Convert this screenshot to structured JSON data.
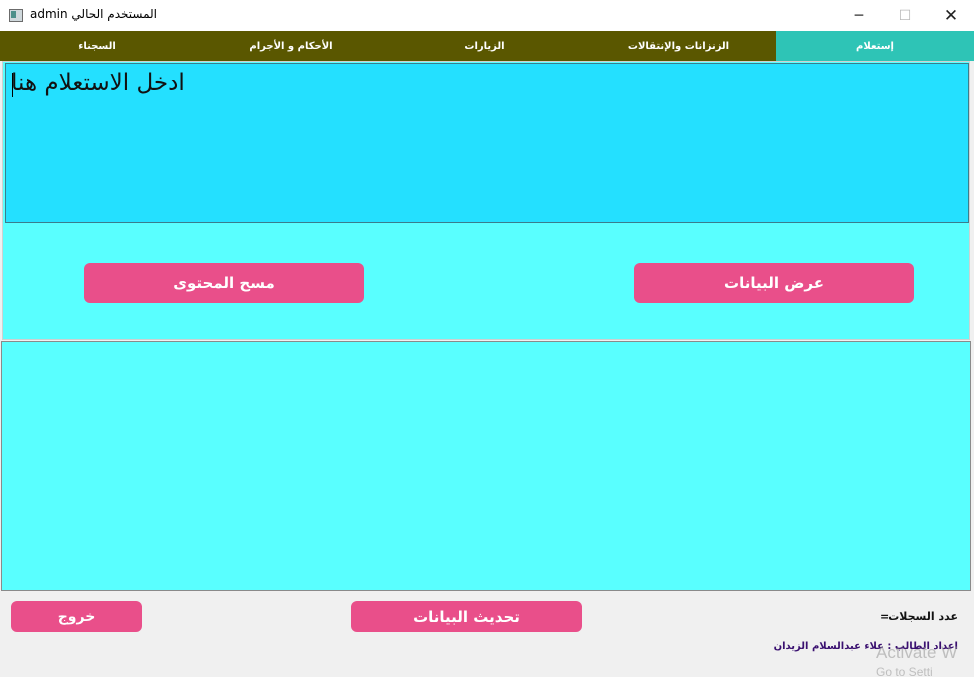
{
  "window": {
    "title": "المستخدم الحالي admin",
    "icon": "app-window-icon",
    "controls": {
      "minimize": "─",
      "maximize": "☐",
      "close": "✕"
    }
  },
  "tabs": [
    {
      "label": "إستعلام",
      "active": true
    },
    {
      "label": "الزنزانات والإنتقالات",
      "active": false
    },
    {
      "label": "الزيارات",
      "active": false
    },
    {
      "label": "الأحكام و الأجرام",
      "active": false
    },
    {
      "label": "السجناء",
      "active": false
    }
  ],
  "query": {
    "text": "ادخل الاستعلام هنا"
  },
  "buttons": {
    "show_data": "عرض البيانات",
    "clear_content": "مسح المحتوى",
    "refresh_data": "تحديث البيانات",
    "exit": "خروج"
  },
  "footer": {
    "records_label": "عدد السجلات",
    "records_count": "=",
    "credit": "اعداد الطالب : علاء عبدالسلام الزيدان"
  },
  "watermark": {
    "line1": "Activate W",
    "line2": "Go to Setti"
  },
  "colors": {
    "tab_bar": "#5a5700",
    "tab_active": "#2ec4b6",
    "query_panel": "#59ffff",
    "query_box": "#24e0ff",
    "button": "#e94f8a",
    "grid": "#59ffff"
  }
}
